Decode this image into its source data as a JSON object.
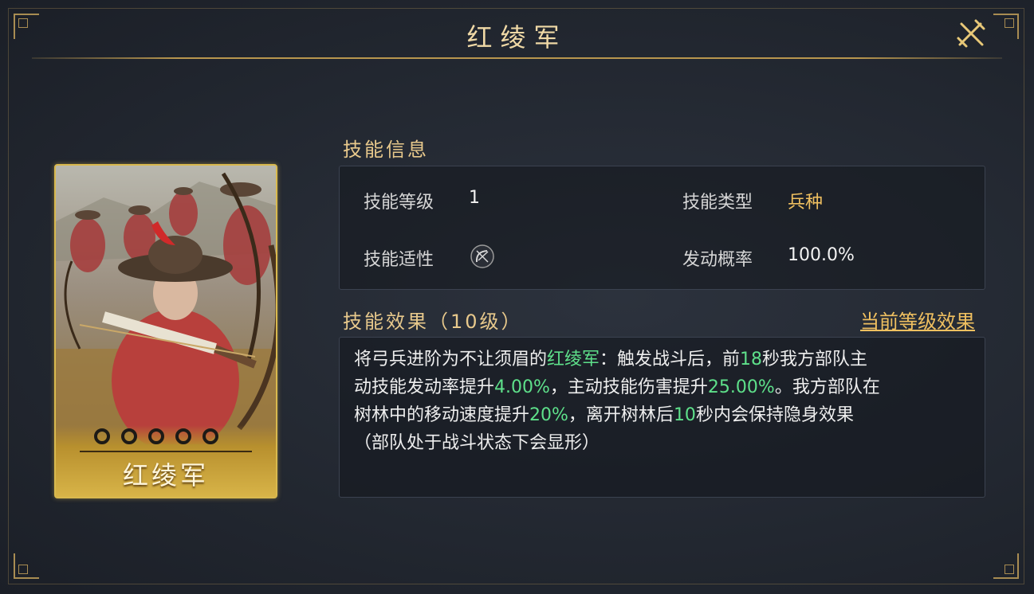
{
  "title": "红绫军",
  "card": {
    "name": "红绫军",
    "stars_total": 5
  },
  "info": {
    "section_title": "技能信息",
    "level_label": "技能等级",
    "level_value": "1",
    "type_label": "技能类型",
    "type_value": "兵种",
    "aptitude_label": "技能适性",
    "aptitude_icon": "bow-aptitude-icon",
    "rate_label": "发动概率",
    "rate_value": "100.0%"
  },
  "effect": {
    "section_title": "技能效果（10级）",
    "current_level_link": "当前等级效果",
    "seg1": "将弓兵进阶为不让须眉的",
    "unit_name": "红绫军",
    "seg2": "：触发战斗后，前",
    "seconds1": "18",
    "seg3": "秒我方部队主",
    "seg4": "动技能发动率提升",
    "pct1": "4.00%",
    "seg5": "，主动技能伤害提升",
    "pct2": "25.00%",
    "seg6": "。我方部队在",
    "seg7": "树林中的移动速度提升",
    "pct3": "20%",
    "seg8": "，离开树林后",
    "seconds2": "10",
    "seg9": "秒内会保持隐身效果",
    "seg10": "（部队处于战斗状态下会显形）"
  },
  "colors": {
    "gold": "#f0c060",
    "highlight_green": "#5ee08a",
    "frame_gold": "#a88c52"
  }
}
